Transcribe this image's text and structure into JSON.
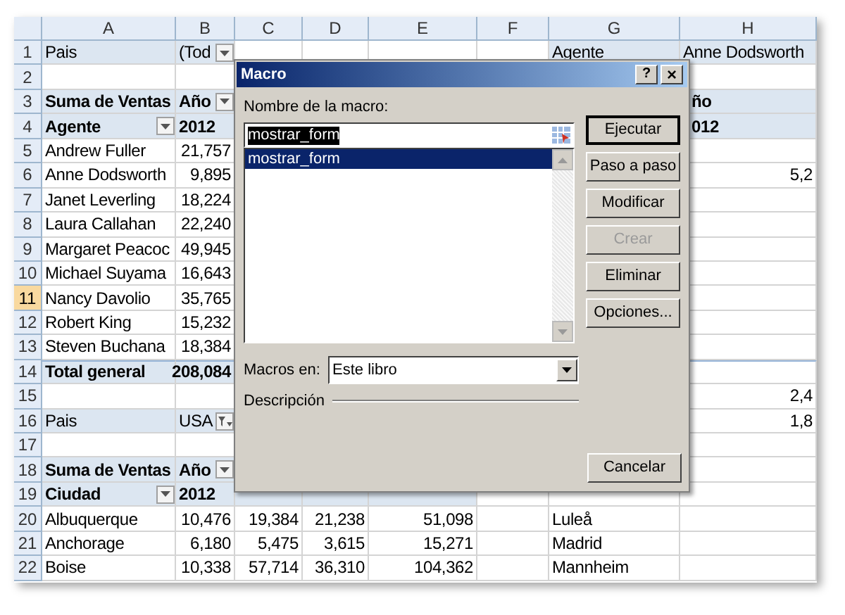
{
  "sheet": {
    "columns": [
      {
        "label": "A",
        "selected": false
      },
      {
        "label": "B",
        "selected": false
      },
      {
        "label": "C",
        "selected": false
      },
      {
        "label": "D",
        "selected": false
      },
      {
        "label": "E",
        "selected": false
      },
      {
        "label": "F",
        "selected": false
      },
      {
        "label": "G",
        "selected": false
      },
      {
        "label": "H",
        "selected": false
      }
    ],
    "rows": [
      {
        "number": "1",
        "selected": false,
        "kind": "plain",
        "cells": [
          {
            "text": "Pais",
            "kind": "text",
            "bold": false,
            "shaded": true
          },
          {
            "text": "(Tod",
            "kind": "text",
            "bold": false,
            "shaded": true,
            "dropdown": true
          },
          {
            "shaded": false
          },
          {
            "shaded": false
          },
          {
            "shaded": false
          },
          {
            "shaded": false
          },
          {
            "text": "Agente",
            "kind": "text",
            "bold": false,
            "shaded": true
          },
          {
            "text": "Anne Dodsworth",
            "kind": "text",
            "bold": false,
            "shaded": true
          }
        ]
      },
      {
        "number": "2",
        "selected": false,
        "kind": "plain",
        "cells": [
          {
            "shaded": false
          },
          {
            "shaded": false
          },
          null,
          null,
          null,
          null,
          null,
          {
            "shaded": false
          }
        ]
      },
      {
        "number": "3",
        "selected": false,
        "kind": "plain",
        "cells": [
          {
            "text": "Suma de Ventas",
            "kind": "text",
            "bold": true,
            "shaded": true
          },
          {
            "text": "Año",
            "kind": "text",
            "bold": true,
            "shaded": true,
            "dropdown": true
          },
          null,
          null,
          null,
          null,
          null,
          {
            "text": "ño",
            "kind": "indent",
            "bold": true,
            "shaded": true
          }
        ]
      },
      {
        "number": "4",
        "selected": false,
        "kind": "plain",
        "cells": [
          {
            "text": "Agente",
            "kind": "text",
            "bold": true,
            "shaded": true,
            "dropdown": true
          },
          {
            "text": "2012",
            "kind": "text",
            "bold": true,
            "shaded": true
          },
          null,
          null,
          null,
          null,
          null,
          {
            "text": "012",
            "kind": "indent",
            "bold": true,
            "shaded": true
          }
        ]
      },
      {
        "number": "5",
        "selected": false,
        "kind": "plain",
        "cells": [
          {
            "text": "Andrew Fuller",
            "kind": "text",
            "bold": false,
            "shaded": false
          },
          {
            "text": "21,757",
            "kind": "number",
            "bold": false,
            "shaded": false
          },
          null,
          null,
          null,
          null,
          null,
          {
            "shaded": false
          }
        ]
      },
      {
        "number": "6",
        "selected": false,
        "kind": "plain",
        "cells": [
          {
            "text": "Anne Dodsworth",
            "kind": "text",
            "bold": false,
            "shaded": false
          },
          {
            "text": "9,895",
            "kind": "number",
            "bold": false,
            "shaded": false
          },
          null,
          null,
          null,
          null,
          null,
          {
            "text": "5,2",
            "kind": "number",
            "bold": false,
            "shaded": false
          }
        ]
      },
      {
        "number": "7",
        "selected": false,
        "kind": "plain",
        "cells": [
          {
            "text": "Janet Leverling",
            "kind": "text",
            "bold": false,
            "shaded": false
          },
          {
            "text": "18,224",
            "kind": "number",
            "bold": false,
            "shaded": false
          },
          null,
          null,
          null,
          null,
          null,
          {
            "shaded": false
          }
        ]
      },
      {
        "number": "8",
        "selected": false,
        "kind": "plain",
        "cells": [
          {
            "text": "Laura Callahan",
            "kind": "text",
            "bold": false,
            "shaded": false
          },
          {
            "text": "22,240",
            "kind": "number",
            "bold": false,
            "shaded": false
          },
          null,
          null,
          null,
          null,
          null,
          {
            "shaded": false
          }
        ]
      },
      {
        "number": "9",
        "selected": false,
        "kind": "plain",
        "cells": [
          {
            "text": "Margaret Peacoc",
            "kind": "text",
            "bold": false,
            "shaded": false
          },
          {
            "text": "49,945",
            "kind": "number",
            "bold": false,
            "shaded": false
          },
          null,
          null,
          null,
          null,
          null,
          {
            "shaded": false
          }
        ]
      },
      {
        "number": "10",
        "selected": false,
        "kind": "plain",
        "cells": [
          {
            "text": "Michael Suyama",
            "kind": "text",
            "bold": false,
            "shaded": false
          },
          {
            "text": "16,643",
            "kind": "number",
            "bold": false,
            "shaded": false
          },
          null,
          null,
          null,
          null,
          null,
          {
            "shaded": false
          }
        ]
      },
      {
        "number": "11",
        "selected": true,
        "kind": "plain",
        "cells": [
          {
            "text": "Nancy Davolio",
            "kind": "text",
            "bold": false,
            "shaded": false
          },
          {
            "text": "35,765",
            "kind": "number",
            "bold": false,
            "shaded": false
          },
          null,
          null,
          null,
          null,
          null,
          {
            "shaded": false
          }
        ]
      },
      {
        "number": "12",
        "selected": false,
        "kind": "plain",
        "cells": [
          {
            "text": "Robert King",
            "kind": "text",
            "bold": false,
            "shaded": false
          },
          {
            "text": "15,232",
            "kind": "number",
            "bold": false,
            "shaded": false
          },
          null,
          null,
          null,
          null,
          null,
          {
            "shaded": false
          }
        ]
      },
      {
        "number": "13",
        "selected": false,
        "kind": "plain",
        "cells": [
          {
            "text": "Steven Buchana",
            "kind": "text",
            "bold": false,
            "shaded": false
          },
          {
            "text": "18,384",
            "kind": "number",
            "bold": false,
            "shaded": false
          },
          null,
          null,
          null,
          null,
          null,
          {
            "shaded": false
          }
        ]
      },
      {
        "number": "14",
        "selected": false,
        "kind": "total",
        "cells": [
          {
            "text": "Total general",
            "kind": "text",
            "bold": true,
            "shaded": true
          },
          {
            "text": "208,084",
            "kind": "number",
            "bold": true,
            "shaded": true
          },
          null,
          null,
          null,
          null,
          null,
          {
            "shaded": false
          }
        ]
      },
      {
        "number": "15",
        "selected": false,
        "kind": "plain",
        "cells": [
          {
            "shaded": false
          },
          {
            "shaded": false
          },
          null,
          null,
          null,
          null,
          null,
          {
            "text": "2,4",
            "kind": "number",
            "bold": false,
            "shaded": false
          }
        ]
      },
      {
        "number": "16",
        "selected": false,
        "kind": "plain",
        "cells": [
          {
            "text": "Pais",
            "kind": "text",
            "bold": false,
            "shaded": true
          },
          {
            "text": "USA",
            "kind": "text",
            "bold": false,
            "shaded": true,
            "filtered": true
          },
          null,
          null,
          null,
          null,
          null,
          {
            "text": "1,8",
            "kind": "number",
            "bold": false,
            "shaded": false
          }
        ]
      },
      {
        "number": "17",
        "selected": false,
        "kind": "plain",
        "cells": [
          {
            "shaded": false
          },
          {
            "shaded": false
          },
          null,
          null,
          null,
          null,
          null,
          {
            "shaded": false
          }
        ]
      },
      {
        "number": "18",
        "selected": false,
        "kind": "plain",
        "cells": [
          {
            "text": "Suma de Ventas",
            "kind": "text",
            "bold": true,
            "shaded": true
          },
          {
            "text": "Año",
            "kind": "text",
            "bold": true,
            "shaded": true,
            "dropdown": true
          },
          null,
          null,
          null,
          null,
          null,
          {
            "shaded": false
          }
        ]
      },
      {
        "number": "19",
        "selected": false,
        "kind": "plain",
        "cells": [
          {
            "text": "Ciudad",
            "kind": "text",
            "bold": true,
            "shaded": true,
            "dropdown": true
          },
          {
            "text": "2012",
            "kind": "text",
            "bold": true,
            "shaded": true
          },
          {
            "shaded": true
          },
          {
            "shaded": true
          },
          {
            "shaded": true
          },
          {
            "shaded": false
          },
          {
            "shaded": false
          },
          {
            "shaded": false
          }
        ]
      },
      {
        "number": "20",
        "selected": false,
        "kind": "plain",
        "cells": [
          {
            "text": "Albuquerque",
            "kind": "text",
            "bold": false,
            "shaded": false
          },
          {
            "text": "10,476",
            "kind": "number",
            "bold": false,
            "shaded": false
          },
          {
            "text": "19,384",
            "kind": "number",
            "bold": false,
            "shaded": false
          },
          {
            "text": "21,238",
            "kind": "number",
            "bold": false,
            "shaded": false
          },
          {
            "text": "51,098",
            "kind": "number",
            "bold": false,
            "shaded": false
          },
          {
            "shaded": false
          },
          {
            "text": "Luleå",
            "kind": "text",
            "bold": false,
            "shaded": false
          },
          {
            "shaded": false
          }
        ]
      },
      {
        "number": "21",
        "selected": false,
        "kind": "plain",
        "cells": [
          {
            "text": "Anchorage",
            "kind": "text",
            "bold": false,
            "shaded": false
          },
          {
            "text": "6,180",
            "kind": "number",
            "bold": false,
            "shaded": false
          },
          {
            "text": "5,475",
            "kind": "number",
            "bold": false,
            "shaded": false
          },
          {
            "text": "3,615",
            "kind": "number",
            "bold": false,
            "shaded": false
          },
          {
            "text": "15,271",
            "kind": "number",
            "bold": false,
            "shaded": false
          },
          {
            "shaded": false
          },
          {
            "text": "Madrid",
            "kind": "text",
            "bold": false,
            "shaded": false
          },
          {
            "shaded": false
          }
        ]
      },
      {
        "number": "22",
        "selected": false,
        "kind": "plain",
        "cells": [
          {
            "text": "Boise",
            "kind": "text",
            "bold": false,
            "shaded": false
          },
          {
            "text": "10,338",
            "kind": "number",
            "bold": false,
            "shaded": false
          },
          {
            "text": "57,714",
            "kind": "number",
            "bold": false,
            "shaded": false
          },
          {
            "text": "36,310",
            "kind": "number",
            "bold": false,
            "shaded": false
          },
          {
            "text": "104,362",
            "kind": "number",
            "bold": false,
            "shaded": false
          },
          {
            "shaded": false
          },
          {
            "text": "Mannheim",
            "kind": "text",
            "bold": false,
            "shaded": false
          },
          {
            "shaded": false
          }
        ]
      }
    ]
  },
  "dialog": {
    "title": "Macro",
    "help_button": "?",
    "close_button": "×",
    "name_label": "Nombre de la macro:",
    "name_value": "mostrar_form",
    "macros": [
      {
        "name": "mostrar_form",
        "selected": true
      }
    ],
    "buttons": [
      {
        "label": "Ejecutar",
        "default": true,
        "disabled": false
      },
      {
        "label": "Paso a paso",
        "default": false,
        "disabled": false
      },
      {
        "label": "Modificar",
        "default": false,
        "disabled": false
      },
      {
        "label": "Crear",
        "default": false,
        "disabled": true
      },
      {
        "label": "Eliminar",
        "default": false,
        "disabled": false
      },
      {
        "label": "Opciones...",
        "default": false,
        "disabled": false
      }
    ],
    "macros_in_label": "Macros en:",
    "macros_in_value": "Este libro",
    "description_label": "Descripción",
    "cancel_button": "Cancelar"
  }
}
